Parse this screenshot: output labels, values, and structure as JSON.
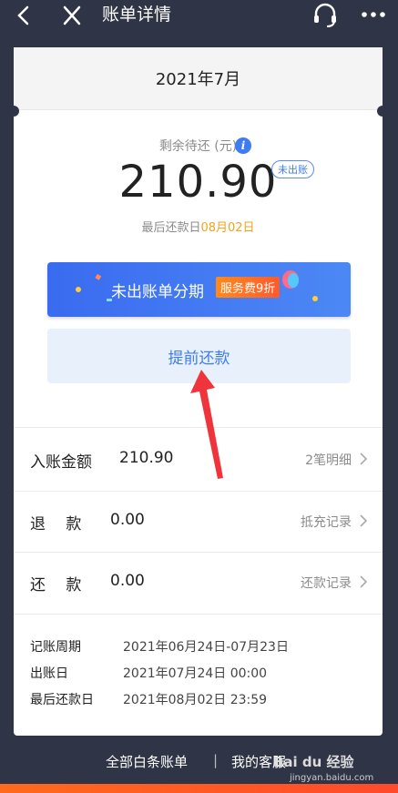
{
  "topbar": {
    "title": "账单详情"
  },
  "card": {
    "month": "2021年7月",
    "remain_label": "剩余待还 (元)",
    "info_glyph": "i",
    "amount": "210.90",
    "badge": "未出账",
    "due_prefix": "最后还款日",
    "due_date": "08月02日"
  },
  "installment": {
    "label": "未出账单分期",
    "fee_tag": "服务费9折"
  },
  "prepay": {
    "label": "提前还款"
  },
  "rows": [
    {
      "label": "入账金额",
      "value": "210.90",
      "link": "2笔明细"
    },
    {
      "label": "退　 款",
      "value": "0.00",
      "link": "抵充记录"
    },
    {
      "label": "还　 款",
      "value": "0.00",
      "link": "还款记录"
    }
  ],
  "details": [
    {
      "label": "记账周期",
      "value": "2021年06月24日-07月23日"
    },
    {
      "label": "出账日",
      "value": "2021年07月24日 00:00"
    },
    {
      "label": "最后还款日",
      "value": "2021年08月02日 23:59"
    }
  ],
  "footer": {
    "all_bills": "全部白条账单",
    "separator": "|",
    "service": "我的客服"
  },
  "watermark": {
    "text": "Bai du 经验",
    "sub": "jingyan.baidu.com"
  },
  "colors": {
    "background": "#2f3446",
    "accent_blue": "#3f7cf0",
    "due_orange": "#f2a31a",
    "fee_orange": "#ff6a1c",
    "arrow_red": "#f0343c"
  }
}
